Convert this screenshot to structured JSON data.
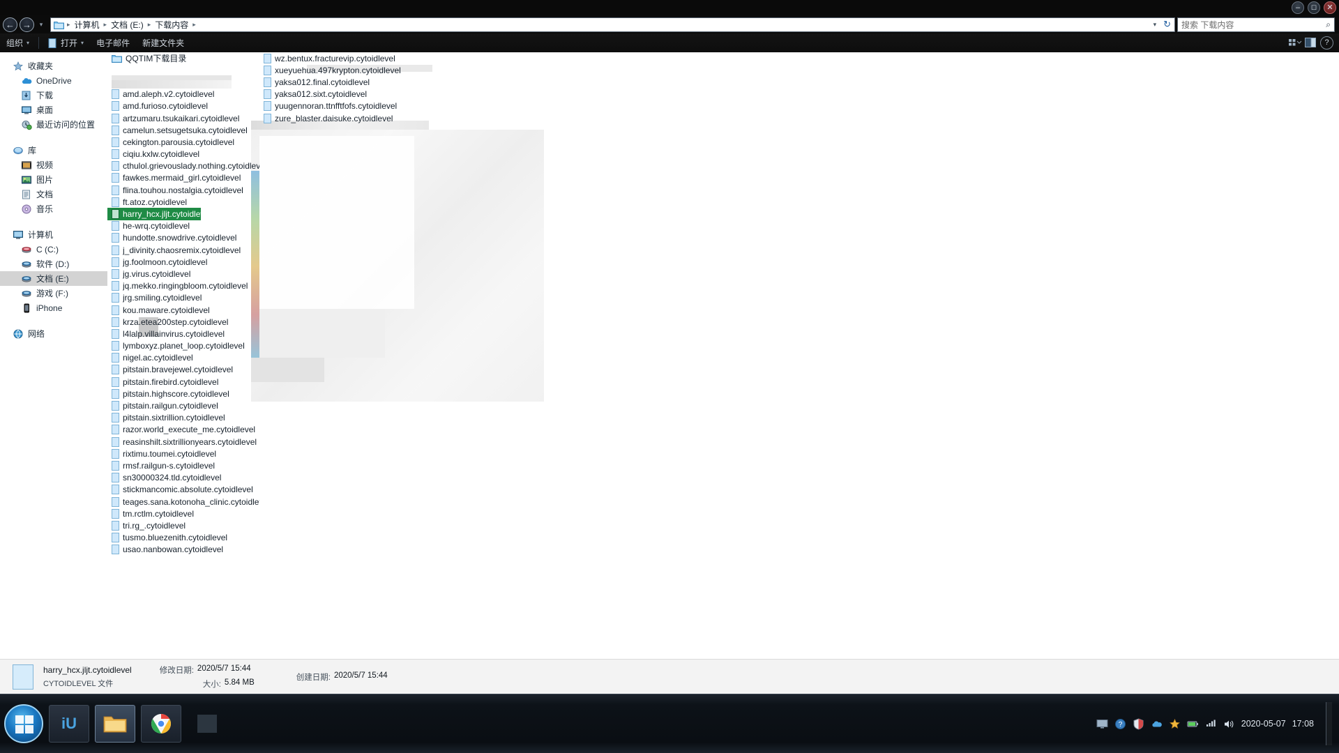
{
  "window": {
    "buttons": [
      {
        "name": "minimize-button",
        "glyph": "–"
      },
      {
        "name": "maximize-button",
        "glyph": "❐"
      },
      {
        "name": "close-button",
        "glyph": "✕"
      }
    ]
  },
  "address": {
    "back_glyph": "←",
    "forward_glyph": "→",
    "history_glyph": "▾",
    "crumbs": [
      "计算机",
      "文档 (E:)",
      "下载内容"
    ],
    "separator": "▸",
    "dropdown_glyph": "▾",
    "refresh_glyph": "↻"
  },
  "search": {
    "placeholder": "搜索 下载内容",
    "icon": "search-icon",
    "glyph": "⌕"
  },
  "commandbar": {
    "organize": "组织",
    "open": "打开",
    "email": "电子邮件",
    "new_folder": "新建文件夹",
    "caret": "▾",
    "help_glyph": "?"
  },
  "sidebar": {
    "groups": [
      {
        "header": {
          "label": "收藏夹",
          "icon": "favorites-star-icon"
        },
        "items": [
          {
            "label": "OneDrive",
            "icon": "onedrive-cloud-icon"
          },
          {
            "label": "下载",
            "icon": "downloads-icon"
          },
          {
            "label": "桌面",
            "icon": "desktop-icon"
          },
          {
            "label": "最近访问的位置",
            "icon": "recent-places-icon"
          }
        ]
      },
      {
        "header": {
          "label": "库",
          "icon": "libraries-icon"
        },
        "items": [
          {
            "label": "视频",
            "icon": "videos-icon"
          },
          {
            "label": "图片",
            "icon": "pictures-icon"
          },
          {
            "label": "文档",
            "icon": "documents-icon"
          },
          {
            "label": "音乐",
            "icon": "music-icon"
          }
        ]
      },
      {
        "header": {
          "label": "计算机",
          "icon": "computer-icon"
        },
        "items": [
          {
            "label": "C (C:)",
            "icon": "harddisk-icon",
            "selected": false
          },
          {
            "label": "软件 (D:)",
            "icon": "harddisk-icon",
            "selected": false
          },
          {
            "label": "文档 (E:)",
            "icon": "harddisk-icon",
            "selected": true
          },
          {
            "label": "游戏 (F:)",
            "icon": "harddisk-icon",
            "selected": false
          },
          {
            "label": "iPhone",
            "icon": "iphone-icon",
            "selected": false
          }
        ]
      },
      {
        "header": {
          "label": "网络",
          "icon": "network-icon"
        },
        "items": []
      }
    ]
  },
  "files": {
    "column1": [
      {
        "name": "QQTIM下载目录",
        "type": "folder"
      },
      {
        "name": "",
        "type": "blank"
      },
      {
        "name": "",
        "type": "blank"
      },
      {
        "name": "amd.aleph.v2.cytoidlevel",
        "type": "file"
      },
      {
        "name": "amd.furioso.cytoidlevel",
        "type": "file"
      },
      {
        "name": "artzumaru.tsukaikari.cytoidlevel",
        "type": "file"
      },
      {
        "name": "camelun.setsugetsuka.cytoidlevel",
        "type": "file"
      },
      {
        "name": "cekington.parousia.cytoidlevel",
        "type": "file"
      },
      {
        "name": "ciqiu.kxlw.cytoidlevel",
        "type": "file"
      },
      {
        "name": "cthulol.grievouslady.nothing.cytoidlevel",
        "type": "file"
      },
      {
        "name": "fawkes.mermaid_girl.cytoidlevel",
        "type": "file"
      },
      {
        "name": "flina.touhou.nostalgia.cytoidlevel",
        "type": "file"
      },
      {
        "name": "ft.atoz.cytoidlevel",
        "type": "file"
      },
      {
        "name": "harry_hcx.jljt.cytoidlevel",
        "type": "file",
        "selected": true
      },
      {
        "name": "he-wrq.cytoidlevel",
        "type": "file"
      },
      {
        "name": "hundotte.snowdrive.cytoidlevel",
        "type": "file"
      },
      {
        "name": "j_divinity.chaosremix.cytoidlevel",
        "type": "file"
      },
      {
        "name": "jg.foolmoon.cytoidlevel",
        "type": "file"
      },
      {
        "name": "jg.virus.cytoidlevel",
        "type": "file"
      },
      {
        "name": "jq.mekko.ringingbloom.cytoidlevel",
        "type": "file"
      },
      {
        "name": "jrg.smiling.cytoidlevel",
        "type": "file"
      },
      {
        "name": "kou.maware.cytoidlevel",
        "type": "file"
      },
      {
        "name": "krza.etea200step.cytoidlevel",
        "type": "file"
      },
      {
        "name": "l4lalp.villainvirus.cytoidlevel",
        "type": "file"
      },
      {
        "name": "lymboxyz.planet_loop.cytoidlevel",
        "type": "file"
      },
      {
        "name": "nigel.ac.cytoidlevel",
        "type": "file"
      },
      {
        "name": "pitstain.bravejewel.cytoidlevel",
        "type": "file"
      },
      {
        "name": "pitstain.firebird.cytoidlevel",
        "type": "file"
      },
      {
        "name": "pitstain.highscore.cytoidlevel",
        "type": "file"
      },
      {
        "name": "pitstain.railgun.cytoidlevel",
        "type": "file"
      },
      {
        "name": "pitstain.sixtrillion.cytoidlevel",
        "type": "file"
      },
      {
        "name": "razor.world_execute_me.cytoidlevel",
        "type": "file"
      },
      {
        "name": "reasinshilt.sixtrillionyears.cytoidlevel",
        "type": "file"
      },
      {
        "name": "rixtimu.toumei.cytoidlevel",
        "type": "file"
      },
      {
        "name": "rmsf.railgun-s.cytoidlevel",
        "type": "file"
      },
      {
        "name": "sn30000324.tld.cytoidlevel",
        "type": "file"
      },
      {
        "name": "stickmancomic.absolute.cytoidlevel",
        "type": "file"
      },
      {
        "name": "teages.sana.kotonoha_clinic.cytoidlevel",
        "type": "file"
      },
      {
        "name": "tm.rctlm.cytoidlevel",
        "type": "file"
      },
      {
        "name": "tri.rg_.cytoidlevel",
        "type": "file"
      },
      {
        "name": "tusmo.bluezenith.cytoidlevel",
        "type": "file"
      },
      {
        "name": "usao.nanbowan.cytoidlevel",
        "type": "file"
      }
    ],
    "column2": [
      {
        "name": "wz.bentux.fracturevip.cytoidlevel",
        "type": "file"
      },
      {
        "name": "xueyuehua.497krypton.cytoidlevel",
        "type": "file"
      },
      {
        "name": "yaksa012.final.cytoidlevel",
        "type": "file"
      },
      {
        "name": "yaksa012.sixt.cytoidlevel",
        "type": "file"
      },
      {
        "name": "yuugennoran.ttnfftfofs.cytoidlevel",
        "type": "file"
      },
      {
        "name": "zure_blaster.daisuke.cytoidlevel",
        "type": "file"
      }
    ]
  },
  "details": {
    "filename": "harry_hcx.jljt.cytoidlevel",
    "filetype": "CYTOIDLEVEL 文件",
    "modified_label": "修改日期:",
    "modified_value": "2020/5/7 15:44",
    "size_label": "大小:",
    "size_value": "5.84 MB",
    "created_label": "创建日期:",
    "created_value": "2020/5/7 15:44"
  },
  "taskbar": {
    "start": "start-orb",
    "buttons": [
      {
        "name": "taskbar-item-iu",
        "label": "iU",
        "active": false
      },
      {
        "name": "taskbar-item-explorer",
        "label": "explorer",
        "active": true
      },
      {
        "name": "taskbar-item-chrome",
        "label": "chrome",
        "active": false
      },
      {
        "name": "taskbar-item-extra",
        "label": "",
        "active": false
      }
    ],
    "tray_icons": [
      "monitor-icon",
      "help-circle-icon",
      "shield-icon",
      "cloud-icon",
      "star-icon",
      "battery-icon",
      "network-icon",
      "volume-icon"
    ],
    "clock_time": "17:08",
    "clock_date": "2020-05-07",
    "show_desktop": "show-desktop-button"
  }
}
